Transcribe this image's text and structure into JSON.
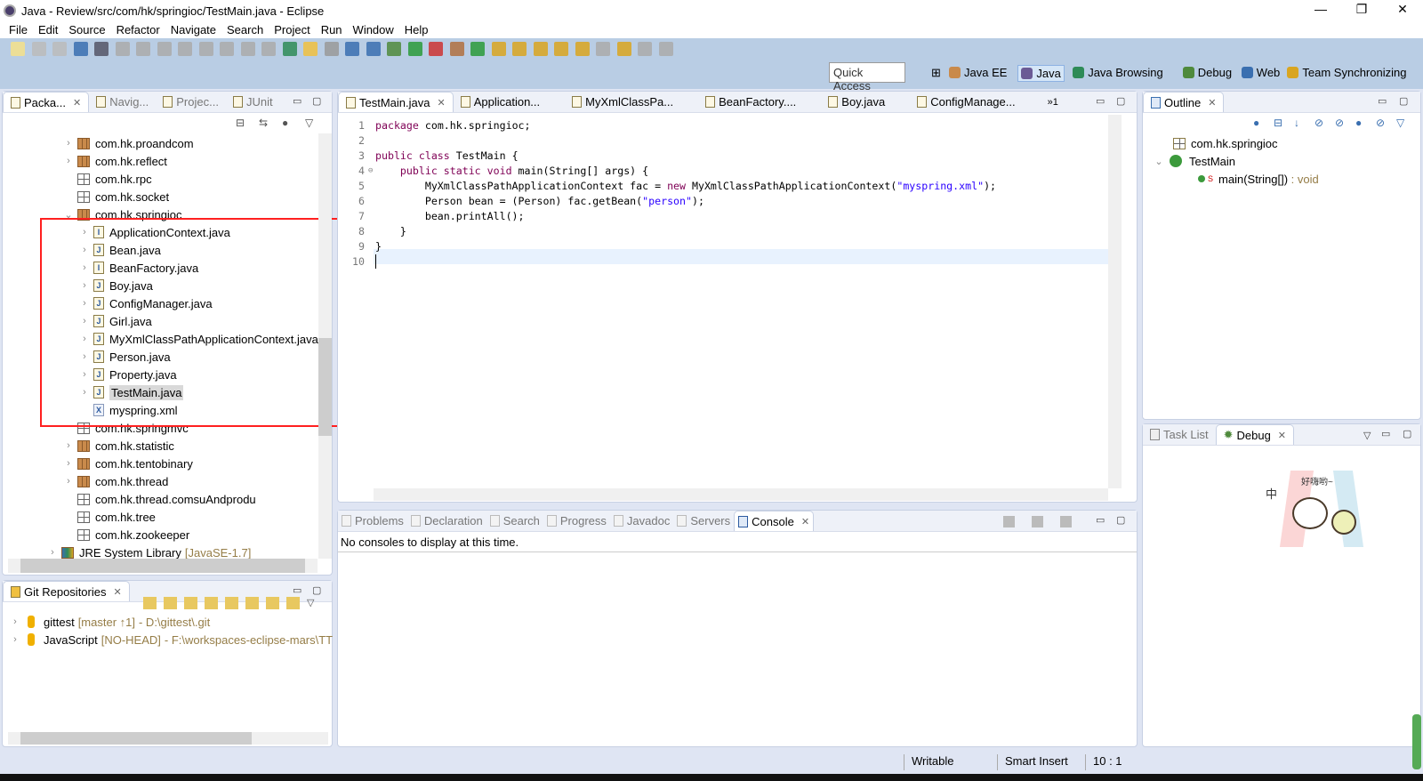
{
  "window": {
    "title": "Java - Review/src/com/hk/springioc/TestMain.java - Eclipse",
    "controls": [
      "—",
      "❐",
      "✕"
    ]
  },
  "menu": [
    "File",
    "Edit",
    "Source",
    "Refactor",
    "Navigate",
    "Search",
    "Project",
    "Run",
    "Window",
    "Help"
  ],
  "toolbar": {
    "quick_access_placeholder": "Quick Access",
    "perspectives": [
      {
        "label": "Java EE",
        "color": "#c98a4b"
      },
      {
        "label": "Java",
        "color": "#6b5b95",
        "active": true
      },
      {
        "label": "Java Browsing",
        "color": "#2e8b57"
      },
      {
        "label": "Debug",
        "color": "#4f8a3c"
      },
      {
        "label": "Web",
        "color": "#3a6fb0"
      },
      {
        "label": "Team Synchronizing",
        "color": "#d9a520"
      }
    ]
  },
  "left_panel": {
    "tabs": [
      "Packa...",
      "Navig...",
      "Projec...",
      "JUnit"
    ],
    "tree": [
      {
        "label": "com.hk.proandcom",
        "level": 1,
        "icon": "package",
        "expand": ">"
      },
      {
        "label": "com.hk.reflect",
        "level": 1,
        "icon": "package",
        "expand": ">"
      },
      {
        "label": "com.hk.rpc",
        "level": 1,
        "icon": "empty-package",
        "expand": ""
      },
      {
        "label": "com.hk.socket",
        "level": 1,
        "icon": "empty-package",
        "expand": ""
      },
      {
        "label": "com.hk.springioc",
        "level": 1,
        "icon": "package",
        "expand": "v"
      },
      {
        "label": "ApplicationContext.java",
        "level": 2,
        "icon": "interface-file",
        "expand": ">"
      },
      {
        "label": "Bean.java",
        "level": 2,
        "icon": "java-file",
        "expand": ">"
      },
      {
        "label": "BeanFactory.java",
        "level": 2,
        "icon": "interface-file",
        "expand": ">"
      },
      {
        "label": "Boy.java",
        "level": 2,
        "icon": "java-file",
        "expand": ">"
      },
      {
        "label": "ConfigManager.java",
        "level": 2,
        "icon": "java-file",
        "expand": ">"
      },
      {
        "label": "Girl.java",
        "level": 2,
        "icon": "java-file",
        "expand": ">"
      },
      {
        "label": "MyXmlClassPathApplicationContext.java",
        "level": 2,
        "icon": "java-file",
        "expand": ">"
      },
      {
        "label": "Person.java",
        "level": 2,
        "icon": "java-file",
        "expand": ">"
      },
      {
        "label": "Property.java",
        "level": 2,
        "icon": "java-file",
        "expand": ">"
      },
      {
        "label": "TestMain.java",
        "level": 2,
        "icon": "java-file",
        "expand": ">",
        "selected": true
      },
      {
        "label": "myspring.xml",
        "level": 2,
        "icon": "xml-file",
        "expand": ""
      },
      {
        "label": "com.hk.springmvc",
        "level": 1,
        "icon": "empty-package",
        "expand": ""
      },
      {
        "label": "com.hk.statistic",
        "level": 1,
        "icon": "package",
        "expand": ">"
      },
      {
        "label": "com.hk.tentobinary",
        "level": 1,
        "icon": "package",
        "expand": ">"
      },
      {
        "label": "com.hk.thread",
        "level": 1,
        "icon": "package",
        "expand": ">"
      },
      {
        "label": "com.hk.thread.comsuAndprodu",
        "level": 1,
        "icon": "empty-package",
        "expand": ""
      },
      {
        "label": "com.hk.tree",
        "level": 1,
        "icon": "empty-package",
        "expand": ""
      },
      {
        "label": "com.hk.zookeeper",
        "level": 1,
        "icon": "empty-package",
        "expand": ""
      },
      {
        "label": "JRE System Library",
        "suffix": "[JavaSE-1.7]",
        "level": 0,
        "icon": "library",
        "expand": ">"
      }
    ],
    "highlight_color": "#ff0000"
  },
  "git_panel": {
    "tab": "Git Repositories",
    "repos": [
      {
        "name": "gittest",
        "branch": "[master ↑1]",
        "path": "- D:\\gittest\\.git"
      },
      {
        "name": "JavaScript",
        "branch": "[NO-HEAD]",
        "path": "- F:\\workspaces-eclipse-mars\\TT"
      }
    ]
  },
  "editor": {
    "tabs": [
      "TestMain.java",
      "Application...",
      "MyXmlClassPa...",
      "BeanFactory....",
      "Boy.java",
      "ConfigManage..."
    ],
    "overflow": "»1",
    "lines": [
      [
        {
          "t": "package",
          "k": "kw"
        },
        {
          "t": " com.hk.springioc;"
        }
      ],
      [],
      [
        {
          "t": "public class",
          "k": "kw"
        },
        {
          "t": " TestMain {"
        }
      ],
      [
        {
          "t": "    "
        },
        {
          "t": "public static void",
          "k": "kw"
        },
        {
          "t": " main(String[] args) {"
        }
      ],
      [
        {
          "t": "        MyXmlClassPathApplicationContext fac = "
        },
        {
          "t": "new",
          "k": "kw"
        },
        {
          "t": " MyXmlClassPathApplicationContext("
        },
        {
          "t": "\"myspring.xml\"",
          "k": "str"
        },
        {
          "t": ");"
        }
      ],
      [
        {
          "t": "        Person bean = (Person) fac.getBean("
        },
        {
          "t": "\"person\"",
          "k": "str"
        },
        {
          "t": ");"
        }
      ],
      [
        {
          "t": "        bean.printAll();"
        }
      ],
      [
        {
          "t": "    }"
        }
      ],
      [
        {
          "t": "}"
        }
      ],
      []
    ]
  },
  "bottom_panel": {
    "tabs": [
      "Problems",
      "Declaration",
      "Search",
      "Progress",
      "Javadoc",
      "Servers",
      "Console"
    ],
    "message": "No consoles to display at this time."
  },
  "outline": {
    "tab": "Outline",
    "items": [
      {
        "label": "com.hk.springioc"
      },
      {
        "label": "TestMain"
      },
      {
        "label": "main(String[])",
        "type": ": void"
      }
    ]
  },
  "debug_panel": {
    "tabs": [
      "Task List",
      "Debug"
    ],
    "sticker_text": "好嗨哟~",
    "side_glyph": "中"
  },
  "status": {
    "writable": "Writable",
    "insert_mode": "Smart Insert",
    "position": "10 : 1"
  }
}
